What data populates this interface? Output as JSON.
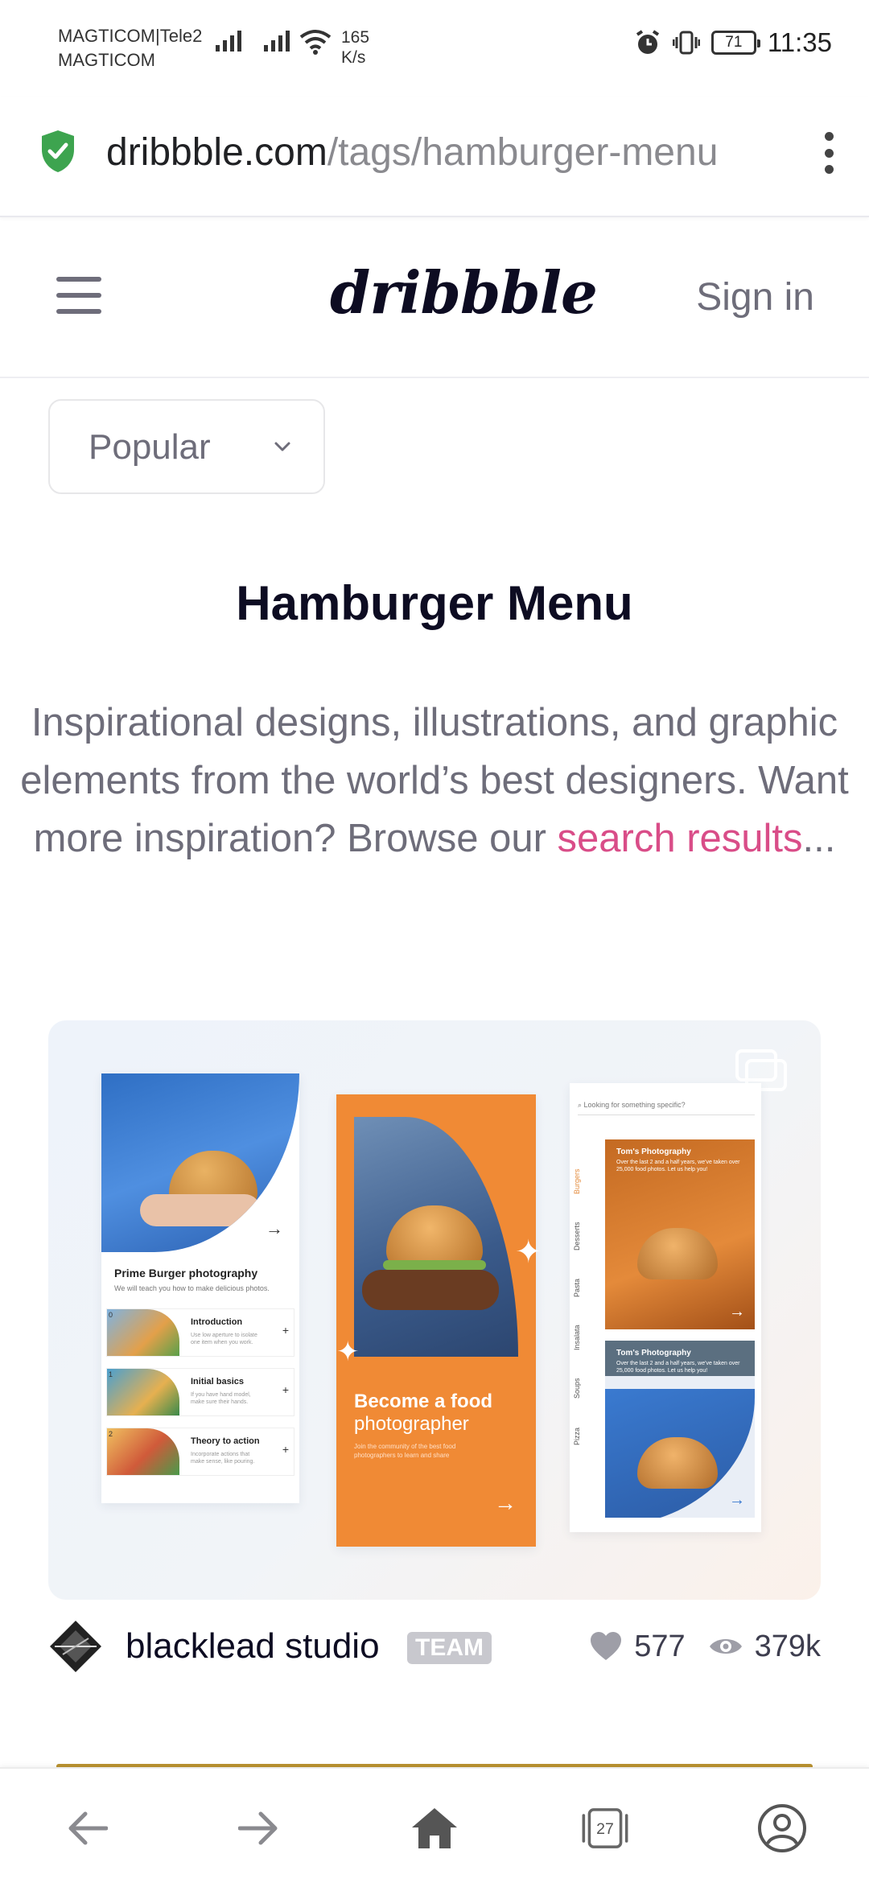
{
  "status_bar": {
    "carrier_1": "MAGTICOM|Tele2",
    "carrier_2": "MAGTICOM",
    "speed_value": "165",
    "speed_unit": "K/s",
    "battery": "71",
    "time": "11:35",
    "icons": [
      "signal-icon",
      "signal-icon",
      "wifi-icon",
      "alarm-icon",
      "vibrate-icon",
      "battery-icon"
    ]
  },
  "browser": {
    "url_domain": "dribbble.com",
    "url_path": "/tags/hamburger-menu",
    "tabs_count": "27"
  },
  "header": {
    "logo": "dribbble",
    "sign_in": "Sign in"
  },
  "filter": {
    "selected": "Popular"
  },
  "page": {
    "title": "Hamburger Menu",
    "description": "Inspirational designs, illustrations, and graphic elements from the world’s best designers. Want more inspiration? Browse our ",
    "link_text": "search results",
    "ellipsis": "..."
  },
  "shot": {
    "panel1_title": "Prime Burger photography",
    "panel1_subtitle": "We will teach you how to make delicious photos.",
    "lessons": [
      {
        "num": "0",
        "title": "Introduction",
        "desc": "Use low aperture to isolate one item when you work."
      },
      {
        "num": "1",
        "title": "Initial basics",
        "desc": "If you have hand model, make sure their hands."
      },
      {
        "num": "2",
        "title": "Theory to action",
        "desc": "Incorporate actions that make sense, like pouring."
      }
    ],
    "panel2_heading_bold": "Become a food",
    "panel2_heading": "photographer",
    "panel2_text": "Join the community of the best food photographers to learn and share",
    "panel3_search": "Looking for something specific?",
    "panel3_categories": [
      "Burgers",
      "Desserts",
      "Pasta",
      "Insalata",
      "Soups",
      "Pizza"
    ],
    "card_title": "Tom's Photography",
    "card_text": "Over the last 2 and a half years, we've taken over 25,000 food photos. Let us help you!"
  },
  "meta": {
    "author": "blacklead studio",
    "badge": "TEAM",
    "likes": "577",
    "views": "379k"
  },
  "colors": {
    "accent_pink": "#d94d88",
    "text_dark": "#0d0c22",
    "text_gray": "#6e6d7a",
    "shot_orange": "#f08a35",
    "secure_green": "#3da44f"
  }
}
